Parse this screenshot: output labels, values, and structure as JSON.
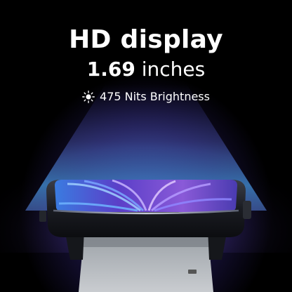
{
  "title": "HD display",
  "size": {
    "value": "1.69",
    "unit": "inches"
  },
  "feature": {
    "icon": "sun-icon",
    "label": "475 Nits Brightness"
  },
  "colors": {
    "background": "#000000",
    "glow_blue": "#4a7be6",
    "glow_violet": "#6a4ad0",
    "text": "#ffffff"
  }
}
